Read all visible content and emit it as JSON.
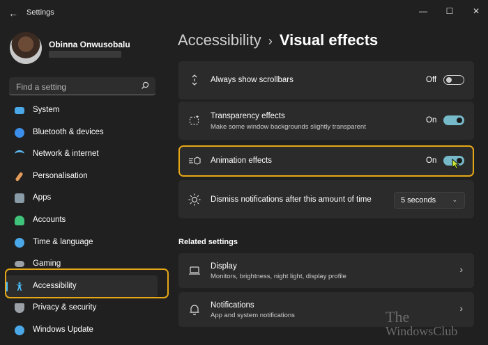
{
  "window": {
    "title": "Settings"
  },
  "user": {
    "name": "Obinna Onwusobalu"
  },
  "search": {
    "placeholder": "Find a setting"
  },
  "sidebar": {
    "items": [
      {
        "label": "System",
        "icon": "monitor-icon",
        "color": "#4aa8e8"
      },
      {
        "label": "Bluetooth & devices",
        "icon": "bluetooth-icon",
        "color": "#3b8eea"
      },
      {
        "label": "Network & internet",
        "icon": "wifi-icon",
        "color": "#5ab8f0"
      },
      {
        "label": "Personalisation",
        "icon": "brush-icon",
        "color": "#e49b5a"
      },
      {
        "label": "Apps",
        "icon": "apps-icon",
        "color": "#8a9ba8"
      },
      {
        "label": "Accounts",
        "icon": "person-icon",
        "color": "#3fc37a"
      },
      {
        "label": "Time & language",
        "icon": "globe-clock-icon",
        "color": "#4aa8e8"
      },
      {
        "label": "Gaming",
        "icon": "gamepad-icon",
        "color": "#9aa0a6"
      },
      {
        "label": "Accessibility",
        "icon": "accessibility-icon",
        "color": "#4cc2ff",
        "active": true
      },
      {
        "label": "Privacy & security",
        "icon": "shield-icon",
        "color": "#9aa0a6"
      },
      {
        "label": "Windows Update",
        "icon": "update-icon",
        "color": "#4aa8e8"
      }
    ]
  },
  "breadcrumb": {
    "parent": "Accessibility",
    "separator": "›",
    "current": "Visual effects"
  },
  "settings": {
    "scrollbars": {
      "title": "Always show scrollbars",
      "state": "Off",
      "on": false
    },
    "transparency": {
      "title": "Transparency effects",
      "desc": "Make some window backgrounds slightly transparent",
      "state": "On",
      "on": true
    },
    "animation": {
      "title": "Animation effects",
      "state": "On",
      "on": true
    },
    "notifications": {
      "title": "Dismiss notifications after this amount of time",
      "value": "5 seconds"
    }
  },
  "related": {
    "title": "Related settings",
    "items": [
      {
        "title": "Display",
        "desc": "Monitors, brightness, night light, display profile"
      },
      {
        "title": "Notifications",
        "desc": "App and system notifications"
      }
    ]
  },
  "watermark": {
    "line1": "The",
    "line2": "WindowsClub"
  },
  "colors": {
    "accent": "#4cc2ff",
    "highlight": "#e6a817",
    "toggle_on": "#76b9c9"
  }
}
